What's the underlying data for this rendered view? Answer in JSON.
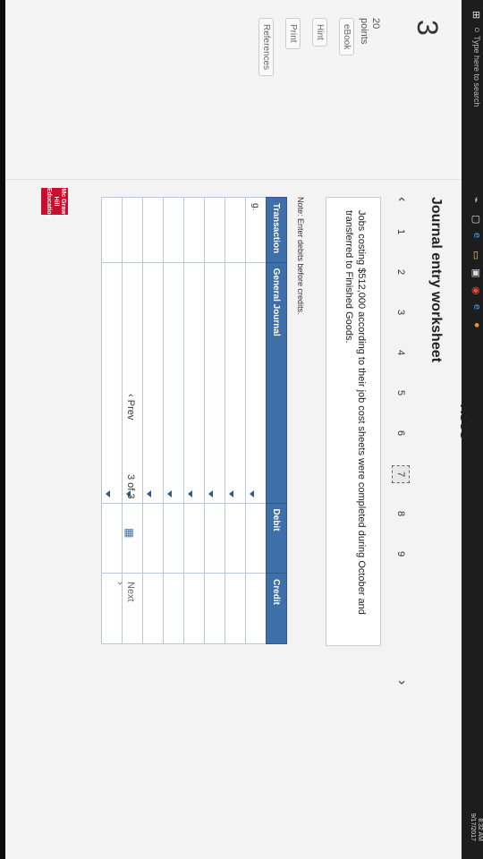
{
  "question": {
    "number": "3",
    "points": "20",
    "points_label": "points"
  },
  "sidebar": {
    "links": [
      "eBook",
      "Hint",
      "Print",
      "References"
    ]
  },
  "worksheet": {
    "title": "Journal entry worksheet",
    "pager": {
      "pages": [
        "1",
        "2",
        "3",
        "4",
        "5",
        "6",
        "7",
        "8",
        "9"
      ],
      "active": "7",
      "prev": "‹",
      "next": "›"
    },
    "prompt": "Jobs costing $512,000 according to their job cost sheets were completed during October and transferred to Finished Goods.",
    "note": "Note: Enter debits before credits.",
    "table": {
      "headers": [
        "Transaction",
        "General Journal",
        "Debit",
        "Credit"
      ],
      "first_transaction": "g.",
      "row_count": 8
    }
  },
  "navigation": {
    "prev": "Prev",
    "count": "3 of 3",
    "next": "Next"
  },
  "taskbar": {
    "search": "Type here to search",
    "time": "8:32 AM",
    "date": "9/17/2017"
  },
  "logo": "Mc Graw Hill Education",
  "device_brand": "ASUS"
}
